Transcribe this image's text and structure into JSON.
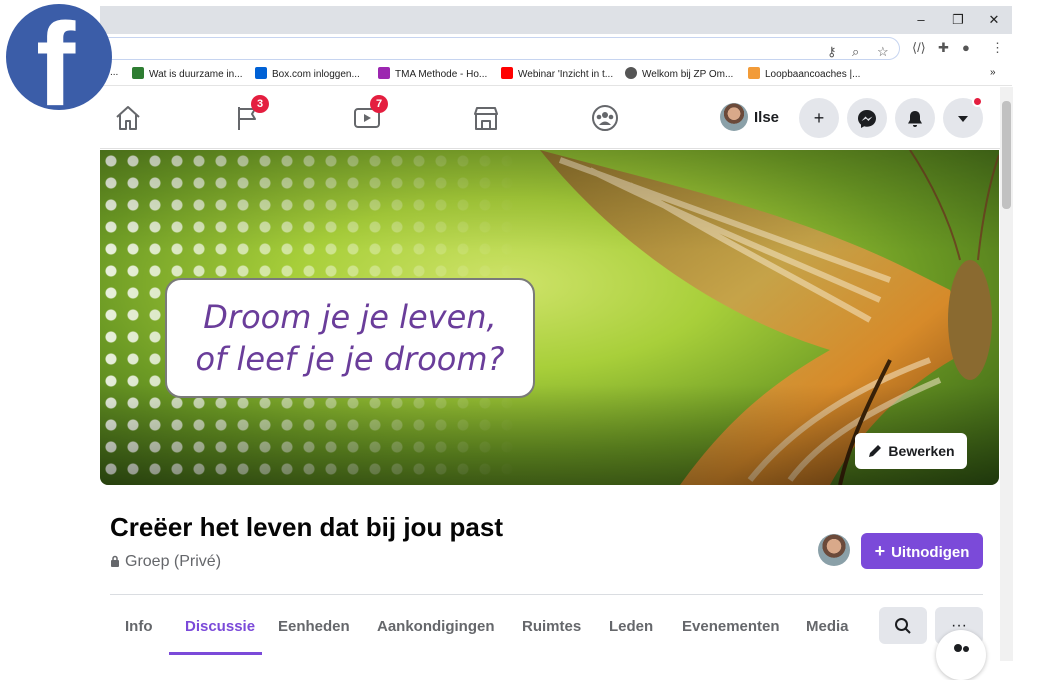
{
  "browser": {
    "window_controls": {
      "minimize": "–",
      "restore": "❐",
      "close": "✕"
    },
    "bookmarks": [
      {
        "label": "...",
        "color": "#ffffff"
      },
      {
        "label": "Wat is duurzame in...",
        "color": "#2e7d32"
      },
      {
        "label": "Box.com inloggen...",
        "color": "#0061d5"
      },
      {
        "label": "TMA Methode - Ho...",
        "color": "#9c27b0"
      },
      {
        "label": "Webinar 'Inzicht in t...",
        "color": "#ff0000"
      },
      {
        "label": "Welkom bij ZP Om...",
        "color": "#555555"
      },
      {
        "label": "Loopbaancoaches |...",
        "color": "#f29b38"
      }
    ],
    "bookmarks_more": "»"
  },
  "fb_logo_letter": "f",
  "nav": {
    "pages_badge": "3",
    "watch_badge": "7",
    "profile_name": "Ilse",
    "create_label": "+"
  },
  "cover": {
    "quote_line1": "Droom je je leven,",
    "quote_line2": "of leef je je droom?",
    "edit_label": "Bewerken"
  },
  "group": {
    "title": "Creëer het leven dat bij jou past",
    "privacy": "Groep (Privé)",
    "invite_label": "Uitnodigen"
  },
  "tabs": [
    {
      "label": "Info"
    },
    {
      "label": "Discussie"
    },
    {
      "label": "Eenheden"
    },
    {
      "label": "Aankondigingen"
    },
    {
      "label": "Ruimtes"
    },
    {
      "label": "Leden"
    },
    {
      "label": "Evenementen"
    },
    {
      "label": "Media"
    }
  ],
  "tab_more_label": "···",
  "colors": {
    "accent": "#7b4ad9",
    "fb_blue": "#3b5da8",
    "badge_red": "#e41e3f"
  }
}
